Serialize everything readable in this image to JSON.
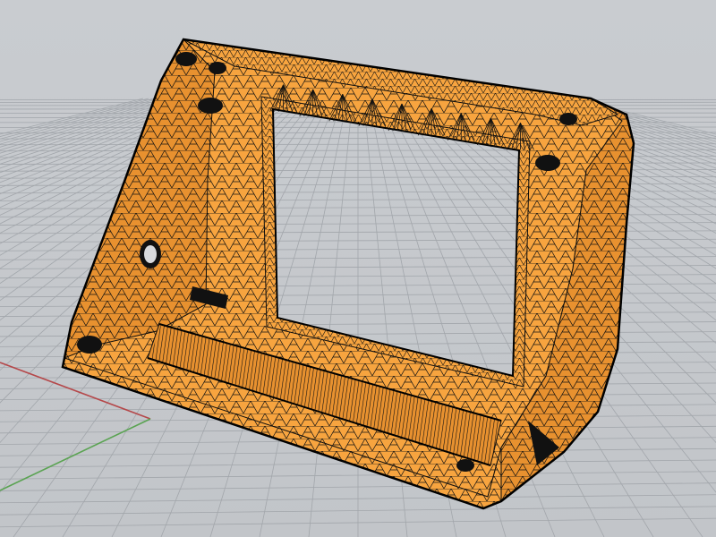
{
  "viewport": {
    "background": "#c5c8cc",
    "grid_color": "#a2a6ab",
    "axis_x_color": "#b5484a",
    "axis_y_color": "#5aa352",
    "mesh_fill": "#f7a43f",
    "mesh_shade": "#e8912f",
    "mesh_edge": "#0d0d0d",
    "display_mode": "wireframe-shaded"
  }
}
